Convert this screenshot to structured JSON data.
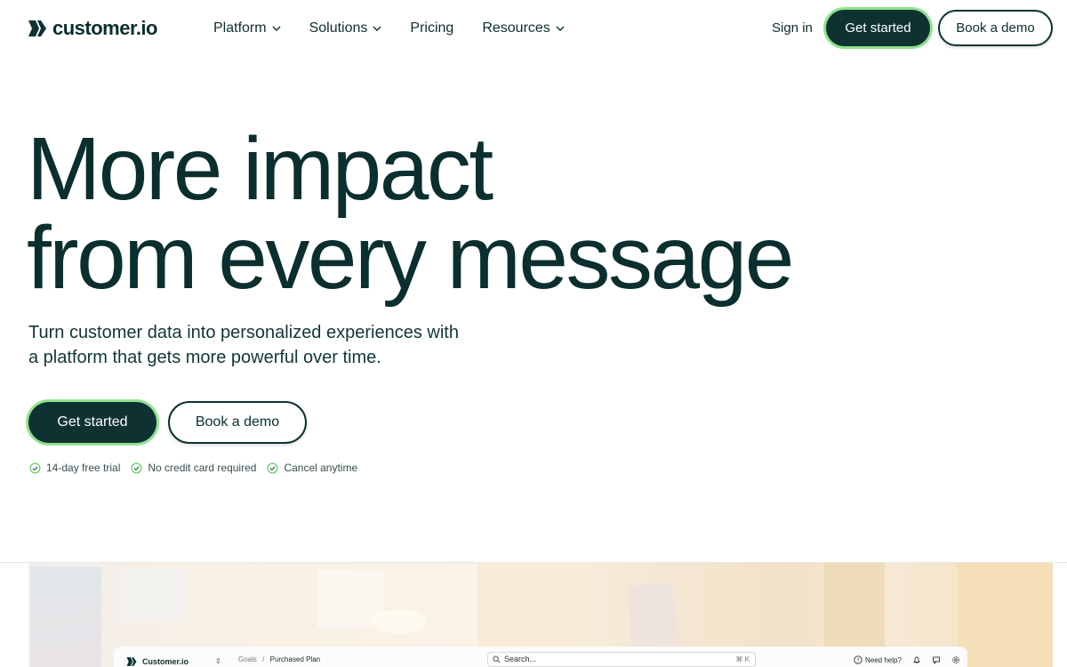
{
  "brand": {
    "name": "customer.io"
  },
  "nav": {
    "items": [
      {
        "label": "Platform",
        "has_dropdown": true
      },
      {
        "label": "Solutions",
        "has_dropdown": true
      },
      {
        "label": "Pricing",
        "has_dropdown": false
      },
      {
        "label": "Resources",
        "has_dropdown": true
      }
    ],
    "sign_in": "Sign in",
    "get_started": "Get started",
    "book_demo": "Book a demo"
  },
  "hero": {
    "headline_line1": "More impact",
    "headline_line2": "from every message",
    "subheading_line1": "Turn customer data into personalized experiences with",
    "subheading_line2": "a platform that gets more powerful over time.",
    "cta_primary": "Get started",
    "cta_secondary": "Book a demo",
    "perks": [
      "14-day free trial",
      "No credit card required",
      "Cancel anytime"
    ]
  },
  "app_preview": {
    "workspace": "Customer.io",
    "breadcrumb": [
      "Goals",
      "Purchased Plan"
    ],
    "breadcrumb_separator": "/",
    "search_placeholder": "Search...",
    "search_shortcut": "⌘ K",
    "help_label": "Need help?"
  },
  "colors": {
    "brand_dark": "#0e3232",
    "accent_green": "#8fe38f",
    "text": "#0b2e2e"
  }
}
